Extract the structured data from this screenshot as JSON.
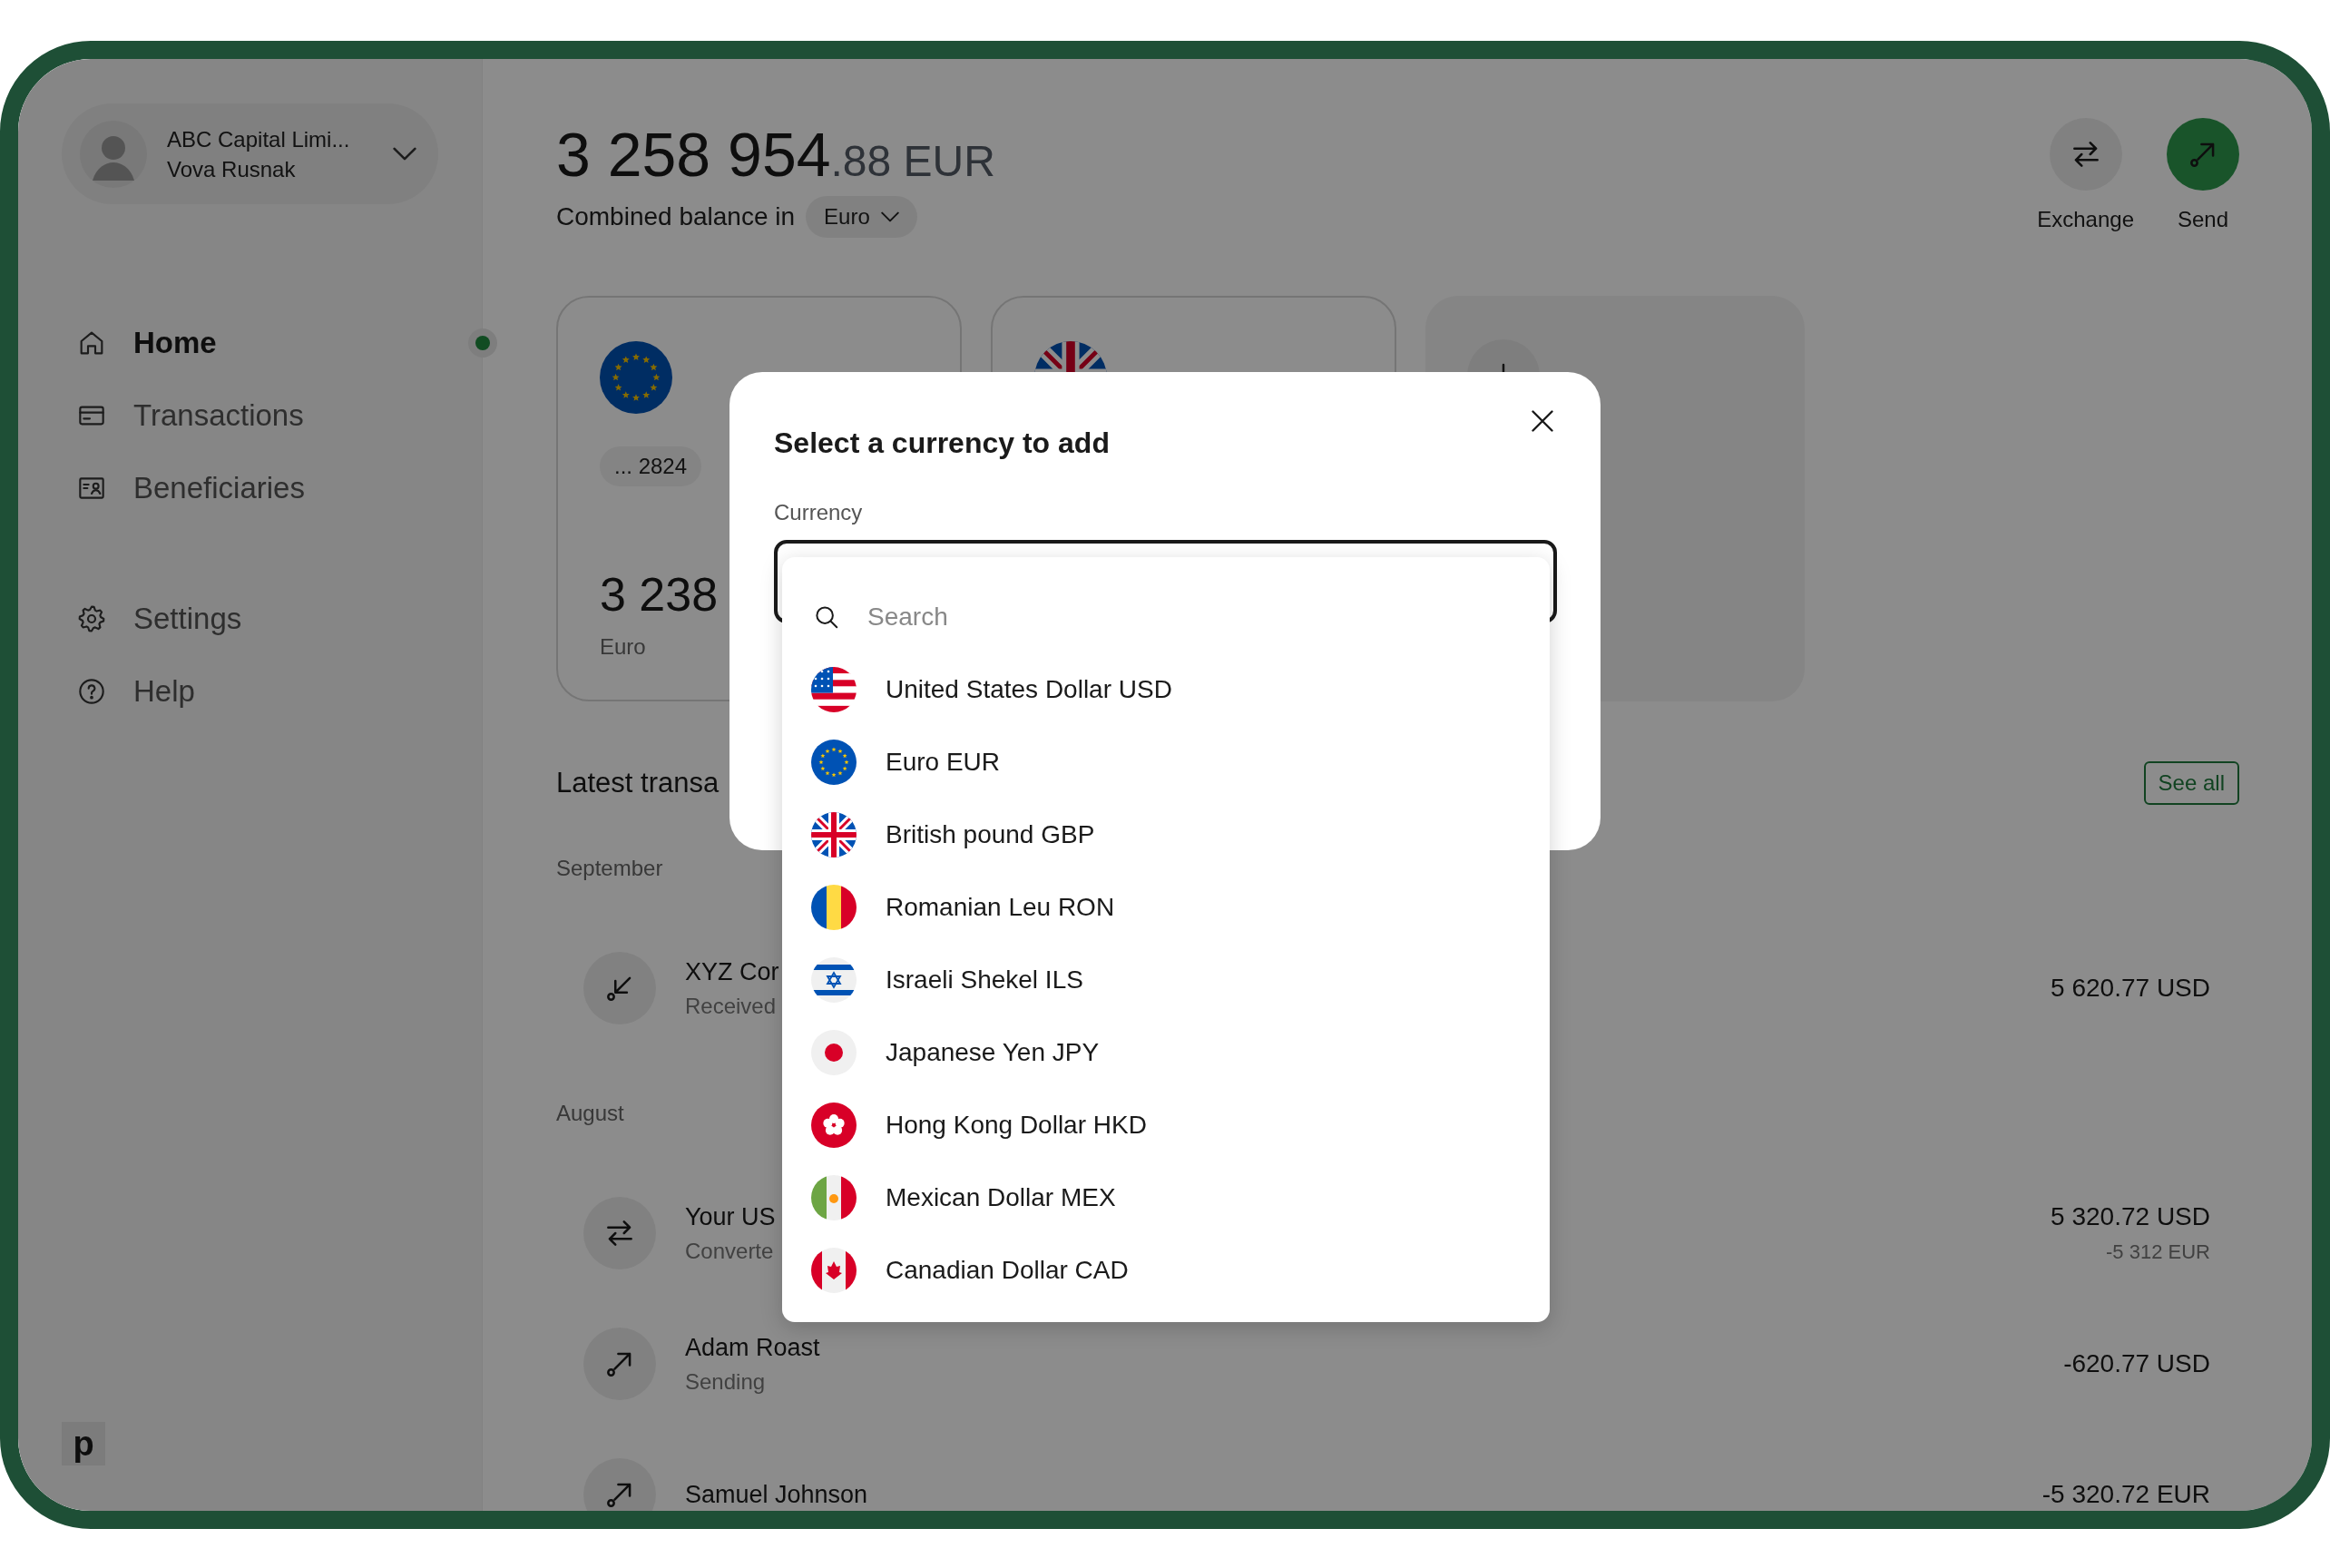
{
  "profile": {
    "company": "ABC Capital Limi...",
    "user": "Vova Rusnak"
  },
  "nav": [
    {
      "items": [
        {
          "label": "Home",
          "kind": "home",
          "selected": true,
          "dot": true
        },
        {
          "label": "Transactions",
          "kind": "card",
          "selected": false,
          "dot": false
        },
        {
          "label": "Beneficiaries",
          "kind": "contact",
          "selected": false,
          "dot": false
        }
      ]
    },
    {
      "items": [
        {
          "label": "Settings",
          "kind": "gear",
          "selected": false,
          "dot": false
        },
        {
          "label": "Help",
          "kind": "help",
          "selected": false,
          "dot": false
        }
      ]
    }
  ],
  "logo": "p",
  "balance": {
    "whole": "3 258 954",
    "fraction": ".88 EUR",
    "caption": "Combined balance in",
    "currency": "Euro"
  },
  "actions": [
    {
      "label": "Exchange",
      "kind": "exchange",
      "primary": false
    },
    {
      "label": "Send",
      "kind": "send",
      "primary": true
    }
  ],
  "accounts": [
    {
      "kind": "account",
      "flag": {
        "kind": "eu"
      },
      "number": "... 2824",
      "amount": "3 238",
      "currency": "Euro"
    },
    {
      "kind": "account",
      "flag": {
        "kind": "gb"
      }
    },
    {
      "kind": "add"
    }
  ],
  "transactions": {
    "title": "Latest transa",
    "see_all": "See all",
    "groups": [
      {
        "month": "September",
        "items": [
          {
            "kind": "received",
            "name": "XYZ Cor",
            "status": "Received",
            "amount": "5 620.77 USD"
          }
        ]
      },
      {
        "month": "August",
        "items": [
          {
            "kind": "converted",
            "name": "Your US",
            "status": "Converte",
            "amount": "5 320.72 USD",
            "secondary": "-5 312 EUR"
          },
          {
            "kind": "sent",
            "name": "Adam Roast",
            "status": "Sending",
            "amount": "-620.77 USD"
          },
          {
            "kind": "sent",
            "name": "Samuel Johnson",
            "amount": "-5 320.72 EUR"
          }
        ]
      }
    ]
  },
  "dialog": {
    "title": "Select a currency to add",
    "field_label": "Currency",
    "search": {
      "placeholder": "Search"
    },
    "options": [
      {
        "label": "United States Dollar USD",
        "flag": {
          "kind": "us"
        }
      },
      {
        "label": "Euro EUR",
        "flag": {
          "kind": "eu"
        }
      },
      {
        "label": "British pound GBP",
        "flag": {
          "kind": "gb"
        }
      },
      {
        "label": "Romanian Leu RON",
        "flag": {
          "kind": "ro"
        }
      },
      {
        "label": "Israeli Shekel ILS",
        "flag": {
          "kind": "il"
        }
      },
      {
        "label": "Japanese Yen JPY",
        "flag": {
          "kind": "jp"
        }
      },
      {
        "label": "Hong Kong Dollar HKD",
        "flag": {
          "kind": "hk"
        }
      },
      {
        "label": "Mexican Dollar MEX",
        "flag": {
          "kind": "mx"
        }
      },
      {
        "label": "Canadian Dollar CAD",
        "flag": {
          "kind": "ca"
        }
      }
    ]
  }
}
